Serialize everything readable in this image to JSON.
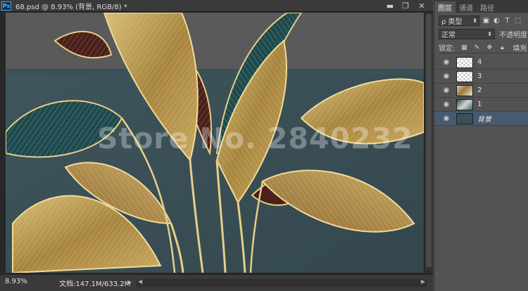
{
  "document": {
    "app_badge": "Ps",
    "title": "68.psd @ 8.93% (背景, RGB/8) *",
    "window_controls": {
      "minimize": "▬",
      "maximize": "❐",
      "close": "✕"
    },
    "watermark": "Store No. 2840232"
  },
  "status_bar": {
    "zoom": "8.93%",
    "doc_size": "文档:147.1M/633.2M",
    "arrow": "▶"
  },
  "panel": {
    "tabs": [
      {
        "label": "图层",
        "active": true
      },
      {
        "label": "通道",
        "active": false
      },
      {
        "label": "路径",
        "active": false
      }
    ],
    "filter": {
      "label": "ρ 类型",
      "arrow": "⬍"
    },
    "blend": {
      "mode": "正常",
      "arrow": "⬍",
      "opacity_label": "不透明度"
    },
    "lock": {
      "label": "锁定:",
      "fill_label": "填充"
    },
    "layers": [
      {
        "name": "4",
        "thumb": "checker",
        "selected": false,
        "italic": false
      },
      {
        "name": "3",
        "thumb": "checker",
        "selected": false,
        "italic": false
      },
      {
        "name": "2",
        "thumb": "gold",
        "selected": false,
        "italic": false
      },
      {
        "name": "1",
        "thumb": "teal",
        "selected": false,
        "italic": false
      },
      {
        "name": "背景",
        "thumb": "bg",
        "selected": true,
        "italic": true
      }
    ]
  },
  "colors": {
    "canvas_bg": "#3b5059",
    "gold": "#b0904e",
    "gold_light": "#e8d394",
    "teal_leaf": "#1c4a4f",
    "maroon_leaf": "#4a1f1c",
    "selection": "#485a6d"
  }
}
